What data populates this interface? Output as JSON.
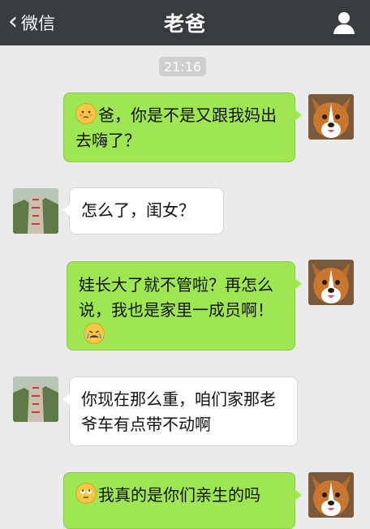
{
  "header": {
    "back_label": "微信",
    "title": "老爸"
  },
  "chat": {
    "timestamp": "21:16",
    "messages": [
      {
        "from": "me",
        "text": "爸，你是不是又跟我妈出去嗨了？",
        "emoji": "blush-emoji"
      },
      {
        "from": "dad",
        "text": "怎么了，闺女？"
      },
      {
        "from": "me",
        "text_before": "娃长大了就不管啦？再怎么说，我也是家里一成员啊！",
        "emoji": "crying-emoji"
      },
      {
        "from": "dad",
        "text": "你现在那么重，咱们家那老爷车有点带不动啊"
      },
      {
        "from": "me",
        "text": "我真的是你们亲生的吗",
        "emoji": "rolleyes-emoji"
      }
    ]
  },
  "colors": {
    "header_bg": "#383b3f",
    "chat_bg": "#ebebeb",
    "my_bubble": "#9fe653",
    "their_bubble": "#ffffff"
  }
}
